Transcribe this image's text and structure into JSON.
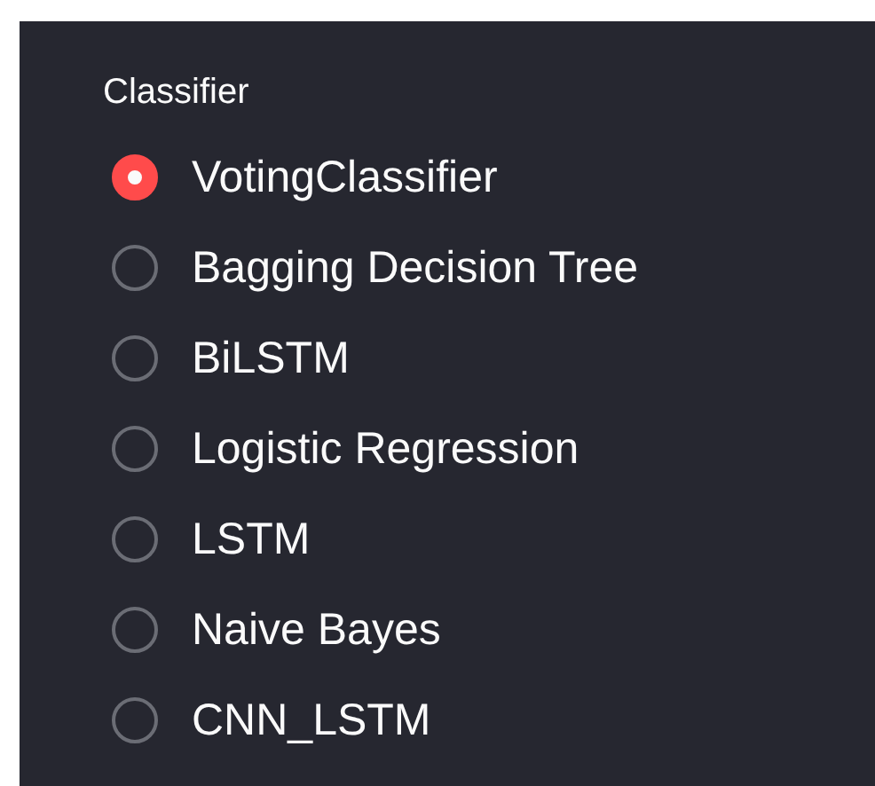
{
  "label": "Classifier",
  "options": [
    {
      "label": "VotingClassifier",
      "selected": true
    },
    {
      "label": "Bagging Decision Tree",
      "selected": false
    },
    {
      "label": "BiLSTM",
      "selected": false
    },
    {
      "label": "Logistic Regression",
      "selected": false
    },
    {
      "label": "LSTM",
      "selected": false
    },
    {
      "label": "Naive Bayes",
      "selected": false
    },
    {
      "label": "CNN_LSTM",
      "selected": false
    }
  ]
}
